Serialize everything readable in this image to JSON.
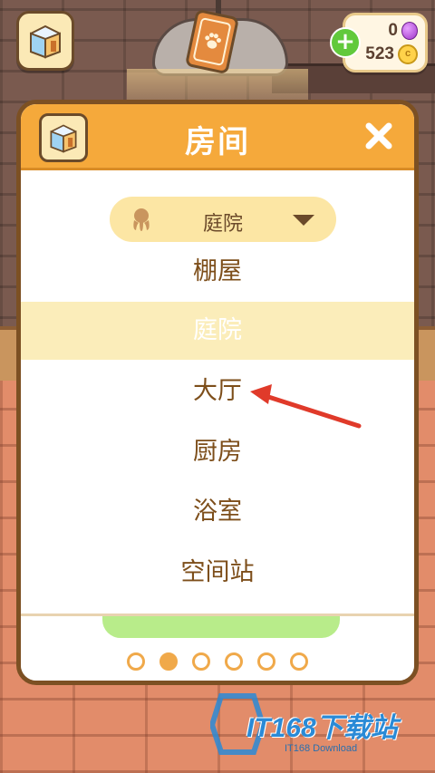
{
  "hud": {
    "gems": "0",
    "coins": "523",
    "coin_symbol": "c",
    "plus": "+"
  },
  "modal": {
    "title": "房间",
    "selected_room": "庭院",
    "rooms": [
      {
        "label": "棚屋",
        "selected": false
      },
      {
        "label": "庭院",
        "selected": true
      },
      {
        "label": "大厅",
        "selected": false
      },
      {
        "label": "厨房",
        "selected": false
      },
      {
        "label": "浴室",
        "selected": false
      },
      {
        "label": "空间站",
        "selected": false
      }
    ],
    "page_count": 6,
    "active_page": 2
  },
  "watermark": {
    "brand": "IT168下载站",
    "sub": "IT168 Download"
  },
  "colors": {
    "header": "#f5a93b",
    "border": "#7c5023",
    "room_text": "#7d4e1a",
    "selected_row": "#fbedba",
    "annotation": "#e03a2a"
  }
}
